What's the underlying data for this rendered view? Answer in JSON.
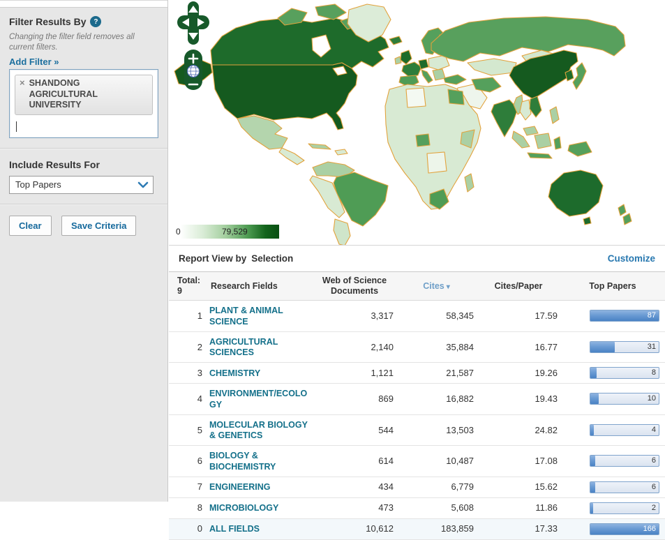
{
  "icons": {
    "help": "?",
    "remove_tag": "×",
    "sort_desc": "▾",
    "zoom_in": "+",
    "zoom_out": "−"
  },
  "sidebar": {
    "filter_title": "Filter Results By",
    "filter_note": "Changing the filter field removes all current filters.",
    "add_filter_label": "Add Filter »",
    "filter_tag": "SHANDONG AGRICULTURAL UNIVERSITY",
    "include_results_label": "Include Results For",
    "include_results_selected": "Top Papers",
    "clear_button": "Clear",
    "save_button": "Save Criteria"
  },
  "map": {
    "legend_min": "0",
    "legend_max": "79,529",
    "palette": {
      "no_data": "#FFFFFF",
      "very_low": "#DCECD8",
      "low": "#ABD0A4",
      "medium": "#55A05C",
      "high": "#2E7D3A",
      "very_high": "#1E6B2B",
      "highest": "#155A1F",
      "border": "#E2A23C",
      "control": "#17592A"
    }
  },
  "report": {
    "title_prefix": "Report View by",
    "title_value": "Selection",
    "customize_label": "Customize",
    "table": {
      "total_label": "Total:",
      "total_count": "9",
      "col_research_fields": "Research Fields",
      "col_docs": "Web of Science Documents",
      "col_cites": "Cites",
      "col_cites_per_paper": "Cites/Paper",
      "col_top_papers": "Top Papers",
      "rows": [
        {
          "rank": "1",
          "field": "PLANT & ANIMAL SCIENCE",
          "docs": "3,317",
          "cites": "58,345",
          "cites_per_paper": "17.59",
          "top_papers": "87",
          "fill_pct": 100,
          "full": true,
          "is_total": false
        },
        {
          "rank": "2",
          "field": "AGRICULTURAL SCIENCES",
          "docs": "2,140",
          "cites": "35,884",
          "cites_per_paper": "16.77",
          "top_papers": "31",
          "fill_pct": 36,
          "full": false,
          "is_total": false
        },
        {
          "rank": "3",
          "field": "CHEMISTRY",
          "docs": "1,121",
          "cites": "21,587",
          "cites_per_paper": "19.26",
          "top_papers": "8",
          "fill_pct": 9,
          "full": false,
          "is_total": false
        },
        {
          "rank": "4",
          "field": "ENVIRONMENT/ECOLOGY",
          "docs": "869",
          "cites": "16,882",
          "cites_per_paper": "19.43",
          "top_papers": "10",
          "fill_pct": 12,
          "full": false,
          "is_total": false
        },
        {
          "rank": "5",
          "field": "MOLECULAR BIOLOGY & GENETICS",
          "docs": "544",
          "cites": "13,503",
          "cites_per_paper": "24.82",
          "top_papers": "4",
          "fill_pct": 5,
          "full": false,
          "is_total": false
        },
        {
          "rank": "6",
          "field": "BIOLOGY & BIOCHEMISTRY",
          "docs": "614",
          "cites": "10,487",
          "cites_per_paper": "17.08",
          "top_papers": "6",
          "fill_pct": 7,
          "full": false,
          "is_total": false
        },
        {
          "rank": "7",
          "field": "ENGINEERING",
          "docs": "434",
          "cites": "6,779",
          "cites_per_paper": "15.62",
          "top_papers": "6",
          "fill_pct": 7,
          "full": false,
          "is_total": false
        },
        {
          "rank": "8",
          "field": "MICROBIOLOGY",
          "docs": "473",
          "cites": "5,608",
          "cites_per_paper": "11.86",
          "top_papers": "2",
          "fill_pct": 4,
          "full": false,
          "is_total": false
        },
        {
          "rank": "0",
          "field": "ALL FIELDS",
          "docs": "10,612",
          "cites": "183,859",
          "cites_per_paper": "17.33",
          "top_papers": "166",
          "fill_pct": 100,
          "full": true,
          "is_total": true
        }
      ]
    }
  }
}
